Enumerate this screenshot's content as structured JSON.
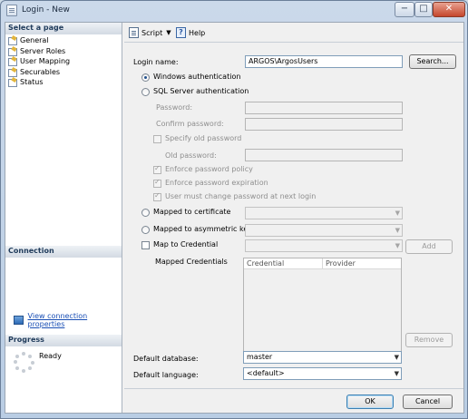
{
  "window": {
    "title": "Login - New",
    "controls": {
      "minimize": "−",
      "maximize": "□",
      "close": "✕"
    }
  },
  "left_pane": {
    "select_page_header": "Select a page",
    "pages": [
      {
        "label": "General"
      },
      {
        "label": "Server Roles"
      },
      {
        "label": "User Mapping"
      },
      {
        "label": "Securables"
      },
      {
        "label": "Status"
      }
    ],
    "connection_header": "Connection",
    "view_connection_link": "View connection properties",
    "progress_header": "Progress",
    "progress_status": "Ready"
  },
  "toolbar": {
    "script_label": "Script",
    "script_dropdown": "▼",
    "help_label": "Help"
  },
  "general": {
    "login_name_label": "Login name:",
    "login_name_value": "ARGOS\\ArgosUsers",
    "search_button": "Search...",
    "windows_auth_label": "Windows authentication",
    "windows_auth_selected": true,
    "sql_auth_label": "SQL Server authentication",
    "password_label": "Password:",
    "confirm_password_label": "Confirm password:",
    "specify_old_password_label": "Specify old password",
    "old_password_label": "Old password:",
    "enforce_policy_label": "Enforce password policy",
    "enforce_expiration_label": "Enforce password expiration",
    "must_change_label": "User must change password at next login",
    "mapped_certificate_label": "Mapped to certificate",
    "mapped_asymmetric_label": "Mapped to asymmetric key",
    "map_credential_label": "Map to Credential",
    "add_button": "Add",
    "mapped_credentials_label": "Mapped Credentials",
    "credentials_columns": [
      "Credential",
      "Provider"
    ],
    "remove_button": "Remove",
    "default_database_label": "Default database:",
    "default_database_value": "master",
    "default_language_label": "Default language:",
    "default_language_value": "<default>"
  },
  "footer": {
    "ok_button": "OK",
    "cancel_button": "Cancel"
  },
  "colors": {
    "link": "#1a4fb5",
    "frame": "#b9cde4",
    "panel": "#f0f0f0"
  }
}
